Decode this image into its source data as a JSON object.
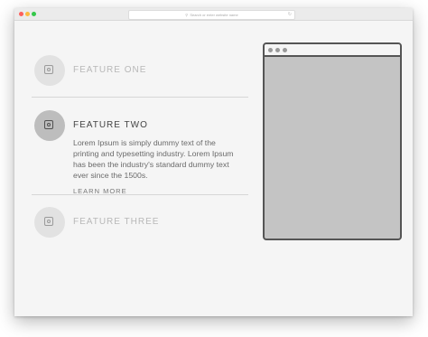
{
  "browser": {
    "address_text": "Search or enter website name",
    "search_icon": "magnifier-icon",
    "reload_icon": "reload-icon",
    "reload_glyph": "↻",
    "search_glyph": "⚲"
  },
  "features": [
    {
      "title": "FEATURE ONE",
      "icon": "square-camera-icon",
      "active": false
    },
    {
      "title": "FEATURE TWO",
      "icon": "square-camera-icon",
      "active": true,
      "description": "Lorem Ipsum is simply dummy text of the printing and typesetting industry. Lorem Ipsum has been the industry's standard dummy text ever since the 1500s.",
      "link_label": "LEARN MORE"
    },
    {
      "title": "FEATURE THREE",
      "icon": "square-camera-icon",
      "active": false
    }
  ],
  "colors": {
    "active_circle": "#bdbdbd",
    "inactive_circle": "#e2e2e2",
    "preview_fill": "#c4c4c4"
  }
}
